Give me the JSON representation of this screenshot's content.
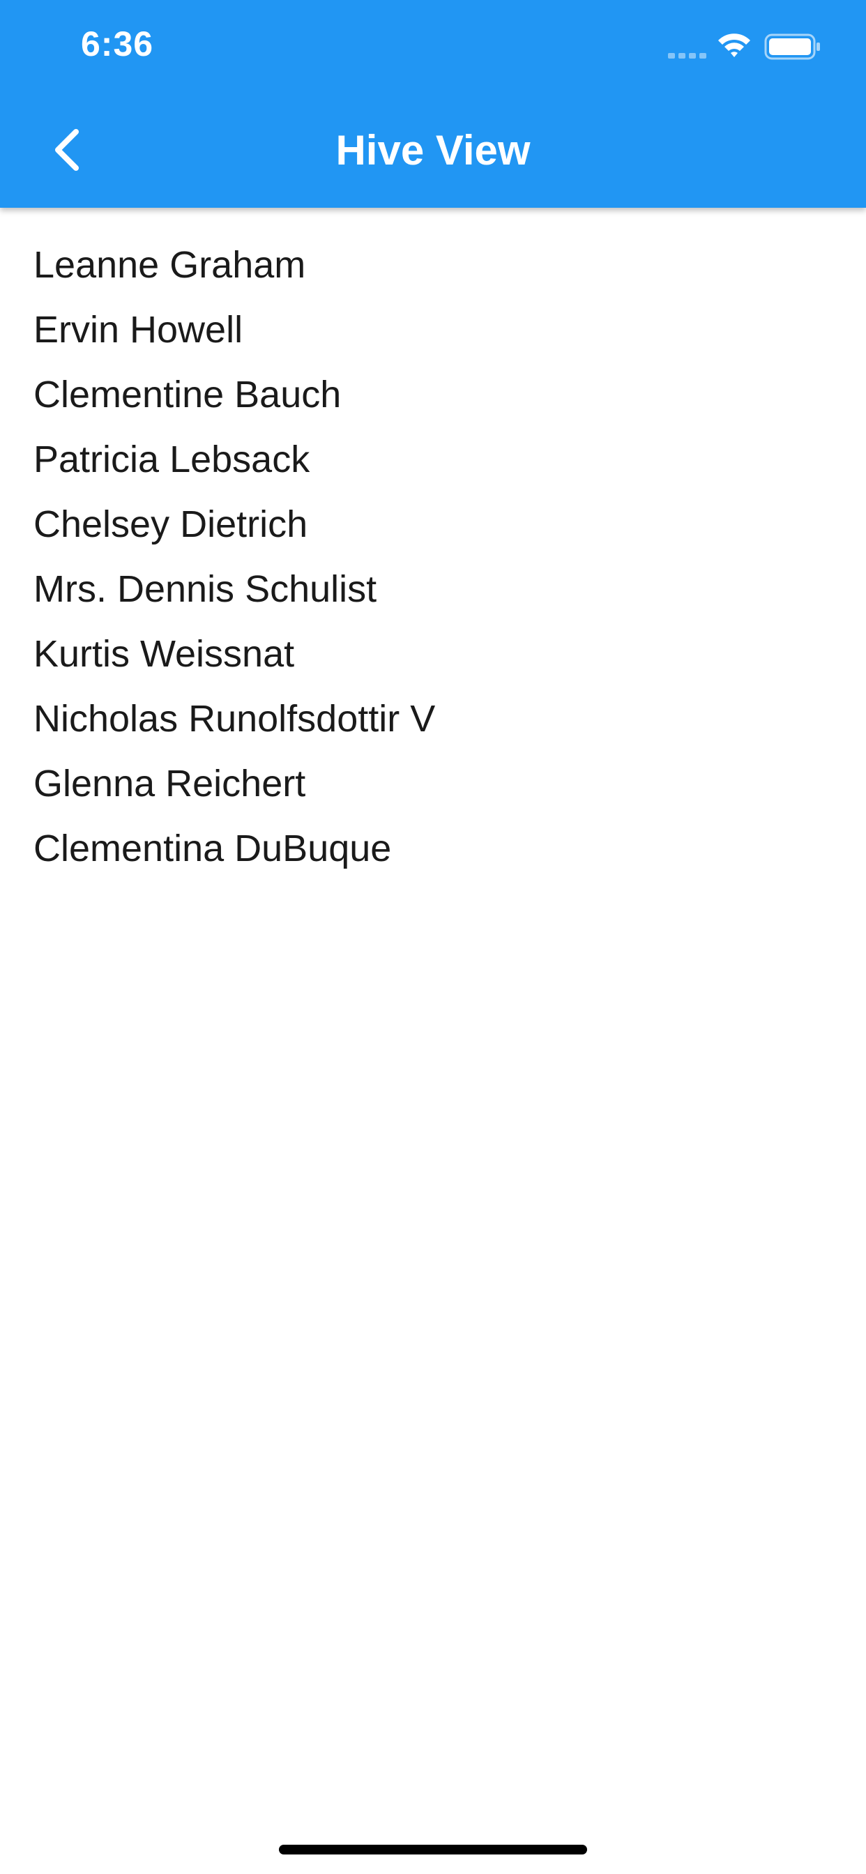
{
  "status_bar": {
    "time": "6:36",
    "icons": [
      "signal-icon",
      "wifi-icon",
      "battery-icon"
    ]
  },
  "app_bar": {
    "title": "Hive View",
    "back_icon": "chevron-left-icon",
    "color": "#2196f3"
  },
  "list": {
    "items": [
      "Leanne Graham",
      "Ervin Howell",
      "Clementine Bauch",
      "Patricia Lebsack",
      "Chelsey Dietrich",
      "Mrs. Dennis Schulist",
      "Kurtis Weissnat",
      "Nicholas Runolfsdottir V",
      "Glenna Reichert",
      "Clementina DuBuque"
    ]
  }
}
